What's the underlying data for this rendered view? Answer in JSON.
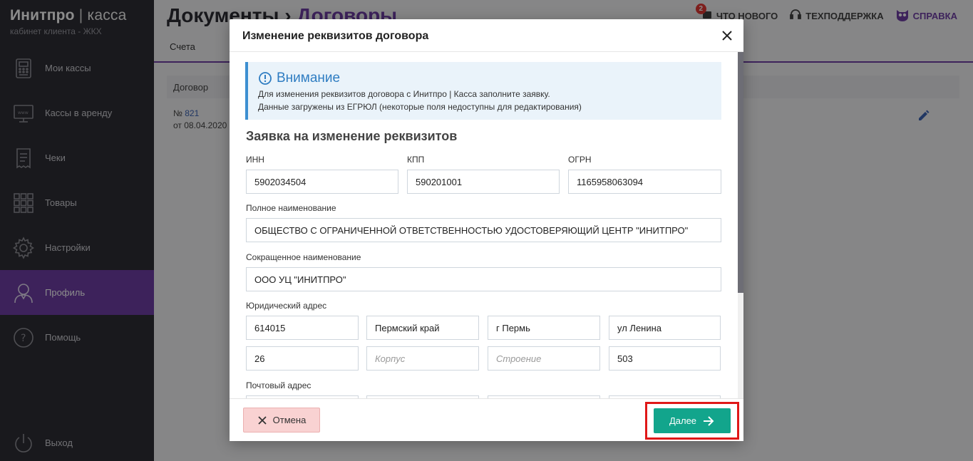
{
  "brand": {
    "title_main": "Инитпро",
    "title_sep": "|",
    "title_light": "касса",
    "subtitle": "кабинет клиента - ЖКХ"
  },
  "sidebar": {
    "items": [
      {
        "label": "Мои кассы",
        "icon": "cash-register-icon"
      },
      {
        "label": "Кассы в аренду",
        "icon": "www-monitor-icon"
      },
      {
        "label": "Чеки",
        "icon": "receipt-icon"
      },
      {
        "label": "Товары",
        "icon": "grid-icon"
      },
      {
        "label": "Настройки",
        "icon": "gear-icon"
      },
      {
        "label": "Профиль",
        "icon": "user-icon",
        "active": true
      },
      {
        "label": "Помощь",
        "icon": "question-icon"
      }
    ],
    "logout_label": "Выход"
  },
  "page": {
    "title": "Документы",
    "crumb_sep": "›",
    "crumb": "Договоры",
    "tab": "Счета",
    "top_links": {
      "whats_new": "ЧТО НОВОГО",
      "whats_new_badge": "2",
      "support": "ТЕХПОДДЕРЖКА",
      "help": "СПРАВКА"
    },
    "table_header": "Договор",
    "row": {
      "num_prefix": "№",
      "num": "821",
      "date": "от 08.04.2020"
    }
  },
  "modal": {
    "title": "Изменение реквизитов договора",
    "notice": {
      "title": "Внимание",
      "line1": "Для изменения реквизитов договора с Инитпро | Касса заполните заявку.",
      "line2": "Данные загружены из ЕГРЮЛ (некоторые поля недоступны для редактирования)"
    },
    "section_title": "Заявка на изменение реквизитов",
    "fields": {
      "inn_label": "ИНН",
      "inn": "5902034504",
      "kpp_label": "КПП",
      "kpp": "590201001",
      "ogrn_label": "ОГРН",
      "ogrn": "1165958063094",
      "full_name_label": "Полное наименование",
      "full_name": "ОБЩЕСТВО С ОГРАНИЧЕННОЙ ОТВЕТСТВЕННОСТЬЮ УДОСТОВЕРЯЮЩИЙ ЦЕНТР \"ИНИТПРО\"",
      "short_name_label": "Сокращенное наименование",
      "short_name": "ООО УЦ \"ИНИТПРО\"",
      "legal_address_label": "Юридический адрес",
      "postal_code": "614015",
      "region": "Пермский край",
      "city": "г Пермь",
      "street": "ул Ленина",
      "house": "26",
      "korpus_placeholder": "Корпус",
      "stroenie_placeholder": "Строение",
      "office": "503",
      "postal_address_label": "Почтовый адрес"
    },
    "cancel_label": "Отмена",
    "next_label": "Далее"
  },
  "colors": {
    "accent": "#6f3fa6",
    "next": "#12a58c",
    "cancel": "#f9d2d2",
    "highlight": "#e01818"
  }
}
